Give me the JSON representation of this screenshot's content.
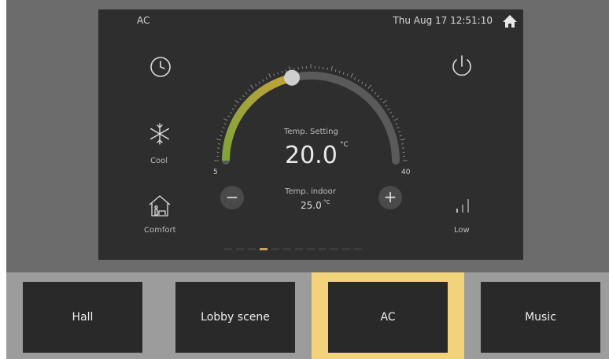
{
  "header": {
    "title": "AC",
    "datetime": "Thu Aug 17  12:51:10"
  },
  "thermostat": {
    "setting_label": "Temp. Setting",
    "setting_value": "20.0",
    "setting_unit": "°C",
    "indoor_label": "Temp. indoor",
    "indoor_value": "25.0",
    "indoor_unit": "°C",
    "scale_min": "5",
    "scale_max": "40",
    "minus_symbol": "−",
    "plus_symbol": "+"
  },
  "modes": {
    "cool_label": "Cool",
    "comfort_label": "Comfort",
    "fan_label": "Low"
  },
  "pager": {
    "count": 12,
    "active_index": 3
  },
  "tiles": [
    {
      "label": "Hall"
    },
    {
      "label": "Lobby scene"
    },
    {
      "label": "AC"
    },
    {
      "label": "Music"
    }
  ],
  "colors": {
    "accent": "#f2d27a",
    "gauge_active": "#7ea43a",
    "gauge_inactive": "#5a5a5a"
  }
}
